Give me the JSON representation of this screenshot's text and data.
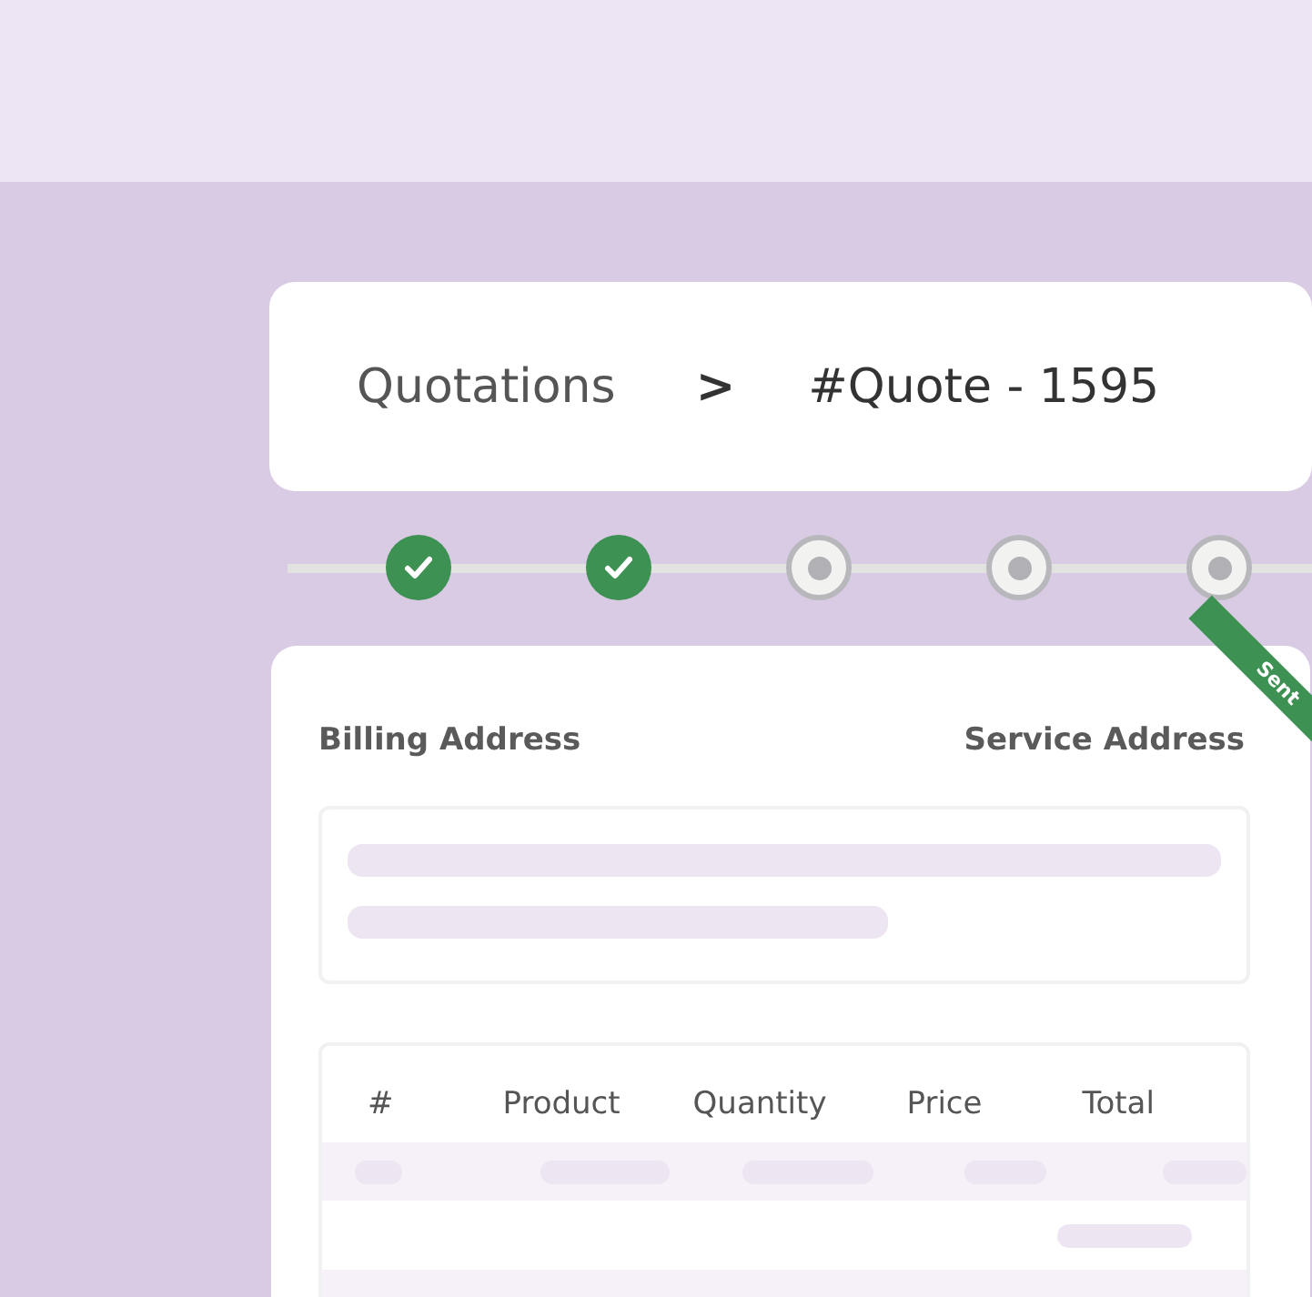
{
  "breadcrumb": {
    "parent": "Quotations",
    "separator": ">",
    "current": "#Quote - 1595"
  },
  "steps": [
    {
      "done": true
    },
    {
      "done": true
    },
    {
      "done": false
    },
    {
      "done": false
    },
    {
      "done": false
    }
  ],
  "card": {
    "ribbon": "Sent",
    "billing_label": "Billing Address",
    "service_label": "Service Address",
    "table": {
      "columns": [
        "#",
        "Product",
        "Quantity",
        "Price",
        "Total"
      ]
    }
  }
}
